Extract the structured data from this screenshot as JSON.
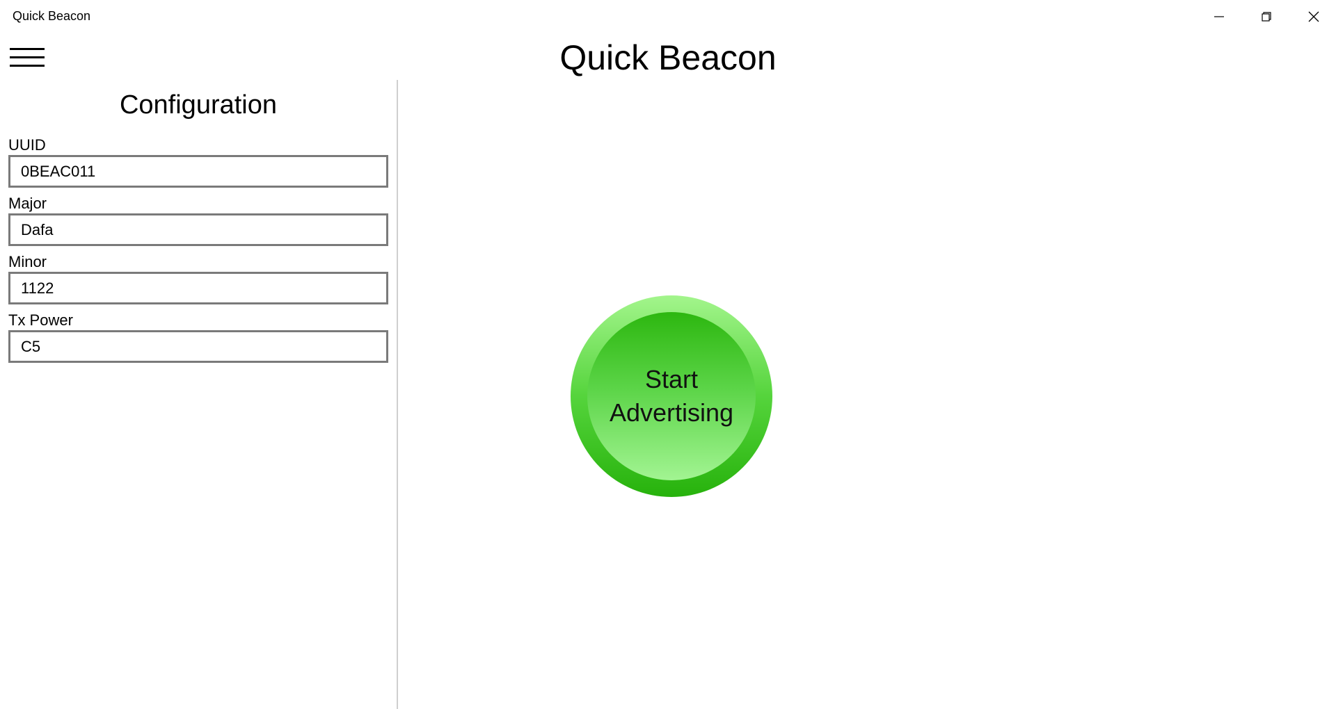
{
  "window": {
    "title": "Quick Beacon",
    "controls": {
      "minimize_icon": "minimize-icon",
      "maximize_icon": "restore-icon",
      "close_icon": "close-icon"
    }
  },
  "header": {
    "menu_icon": "hamburger-menu-icon",
    "title": "Quick Beacon"
  },
  "config": {
    "title": "Configuration",
    "fields": [
      {
        "label": "UUID",
        "value": "0BEAC011"
      },
      {
        "label": "Major",
        "value": "Dafa"
      },
      {
        "label": "Minor",
        "value": "1122"
      },
      {
        "label": "Tx Power",
        "value": "C5"
      }
    ]
  },
  "main": {
    "start_button": {
      "line1": "Start",
      "line2": "Advertising"
    }
  },
  "colors": {
    "button_green_light": "#a3f58c",
    "button_green_dark": "#27b20c",
    "field_border": "#7a7a7a",
    "divider": "#cfcfcf"
  }
}
